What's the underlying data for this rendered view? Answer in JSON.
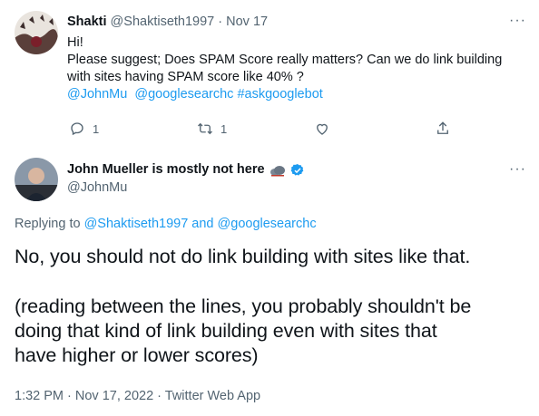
{
  "tweet1": {
    "name": "Shakti",
    "handle": "@Shaktiseth1997",
    "sep": "·",
    "date": "Nov 17",
    "line1": "Hi!",
    "line2": "Please suggest; Does SPAM Score really matters? Can we do link building",
    "line3": "with sites having SPAM score like 40% ?",
    "tags": [
      "@JohnMu",
      "@googlesearchc",
      "#askgooglebot"
    ],
    "reply_count": "1",
    "retweet_count": "1",
    "icons": [
      "reply-icon",
      "retweet-icon",
      "like-icon",
      "share-icon",
      "more-icon"
    ]
  },
  "tweet2": {
    "name": "John Mueller is mostly not here",
    "name_emoji": "cloud-icon",
    "handle": "@JohnMu",
    "replying_prefix": "Replying to",
    "replying_user1": "@Shaktiseth1997",
    "replying_and": "and",
    "replying_user2": "@googlesearchc",
    "text1": "No, you should not do link building with sites like that.",
    "text2_l1": "(reading between the lines, you probably shouldn't be",
    "text2_l2": "doing that kind of link building even with sites that",
    "text2_l3": "have higher or lower scores)",
    "timestamp": "1:32 PM · Nov 17, 2022 · Twitter Web App"
  },
  "colors": {
    "link": "#1d9bf0",
    "muted": "#536471",
    "text": "#0f1419"
  }
}
